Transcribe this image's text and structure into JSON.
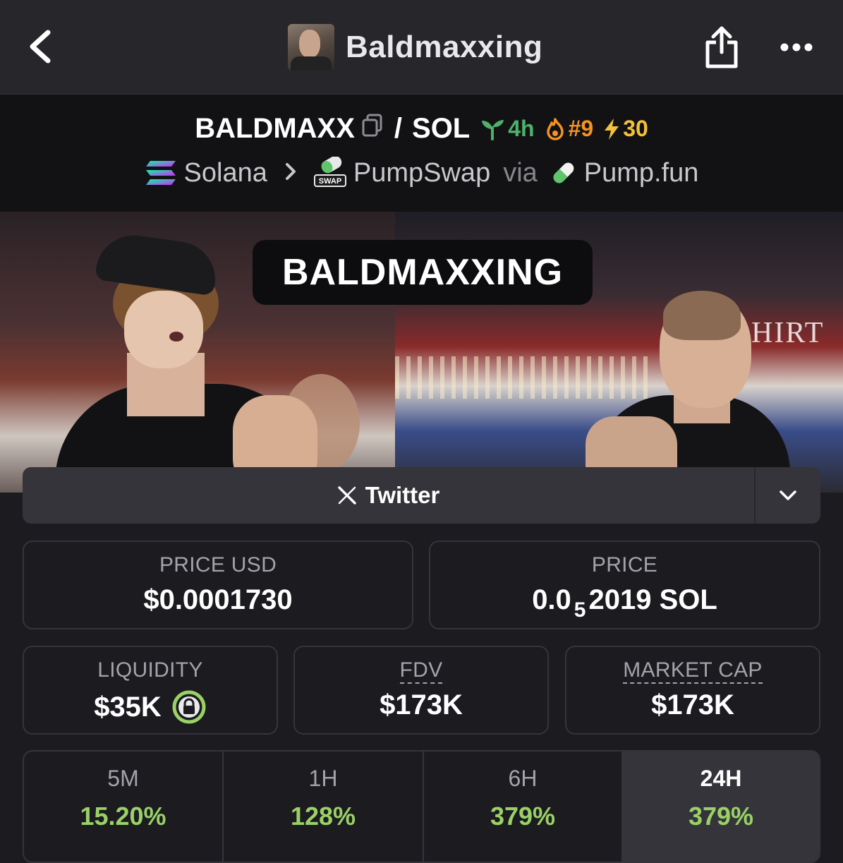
{
  "nav": {
    "title": "Baldmaxxing"
  },
  "pair": {
    "base": "BALDMAXX",
    "separator": "/",
    "quote": "SOL",
    "age": "4h",
    "rank": "#9",
    "boosts": "30"
  },
  "chain": {
    "network": "Solana",
    "dex": "PumpSwap",
    "via": "via",
    "launchpad": "Pump.fun",
    "swap_badge": "SWAP"
  },
  "banner": {
    "label": "BALDMAXXING",
    "sign": "HIRT"
  },
  "social": {
    "twitter_label": "Twitter",
    "icon": "x-logo-icon"
  },
  "stats": {
    "price_usd": {
      "label": "PRICE USD",
      "value": "$0.0001730"
    },
    "price": {
      "label": "PRICE",
      "prefix": "0.0",
      "zeros": "5",
      "digits": "2019 SOL"
    },
    "liquidity": {
      "label": "LIQUIDITY",
      "value": "$35K"
    },
    "fdv": {
      "label": "FDV",
      "value": "$173K"
    },
    "market_cap": {
      "label": "MARKET CAP",
      "value": "$173K"
    }
  },
  "timeframes": [
    {
      "label": "5M",
      "change": "15.20%"
    },
    {
      "label": "1H",
      "change": "128%"
    },
    {
      "label": "6H",
      "change": "379%"
    },
    {
      "label": "24H",
      "change": "379%",
      "active": true
    }
  ],
  "colors": {
    "accent_green": "#9ad166",
    "age_green": "#4fb06a",
    "rank_orange": "#f59322",
    "boost_yellow": "#f2c23a",
    "lock_green": "#9ad166"
  }
}
